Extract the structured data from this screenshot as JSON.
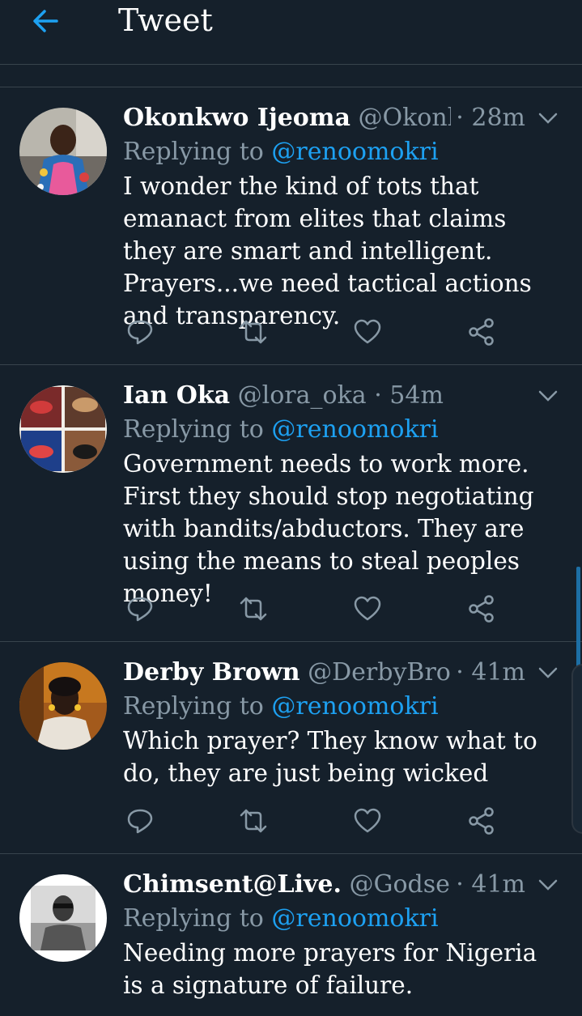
{
  "header": {
    "title": "Tweet",
    "back_icon": "arrow-left-icon"
  },
  "colors": {
    "background": "#15202b",
    "accent": "#1da1f2",
    "muted": "#8899a6",
    "divider": "#38444d"
  },
  "tweets": [
    {
      "name": "Okonkwo Ijeoma",
      "handle": "@Okonk...",
      "time": "· 28m",
      "replying_label": "Replying to",
      "replying_to": "@renoomokri",
      "text": "I wonder the kind of tots that emanact from elites that claims they are smart and intelligent. Prayers...we need tactical actions and transparency."
    },
    {
      "name": "Ian Oka",
      "handle": "@lora_oka",
      "time": "· 54m",
      "replying_label": "Replying to",
      "replying_to": "@renoomokri",
      "text": "Government needs to work more. First they should stop negotiating with bandits/abductors. They are using the means to steal peoples money!"
    },
    {
      "name": "Derby Brown",
      "handle": "@DerbyBrow...",
      "time": "· 41m",
      "replying_label": "Replying to",
      "replying_to": "@renoomokri",
      "text": "Which prayer? They know what to do, they are just being wicked"
    },
    {
      "name": "Chimsent@Live.",
      "handle": "@GodsentC...",
      "time": "· 41m",
      "replying_label": "Replying to",
      "replying_to": "@renoomokri",
      "text": "Needing more prayers for Nigeria is a signature of failure."
    }
  ],
  "action_icons": [
    "reply-icon",
    "retweet-icon",
    "like-icon",
    "share-icon"
  ]
}
